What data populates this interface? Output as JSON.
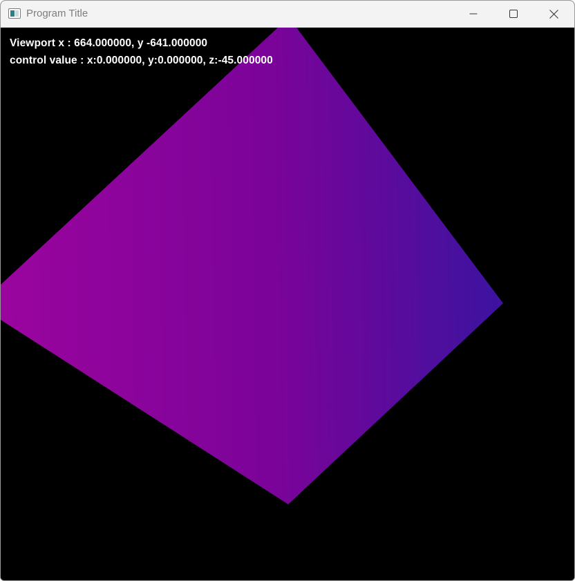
{
  "window": {
    "title": "Program Title",
    "icon": "application-window-icon",
    "controls": [
      "minimize-icon",
      "maximize-icon",
      "close-icon"
    ]
  },
  "viewport": {
    "background_color": "#000000",
    "overlay": {
      "viewport_label": "Viewport x : 664.000000, y -641.000000",
      "control_label": "control value : x:0.000000, y:0.000000, z:-45.000000"
    },
    "shape": {
      "type": "quad",
      "gradient_colors": [
        "#9a059e",
        "#7a0399",
        "#3c13a0"
      ]
    }
  }
}
